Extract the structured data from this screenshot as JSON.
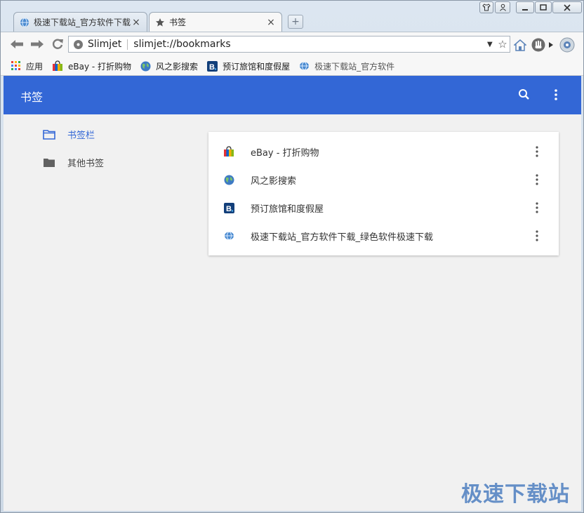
{
  "tabs": [
    {
      "title": "极速下载站_官方软件下载",
      "close": "×",
      "icon": "globe-icon"
    },
    {
      "title": "书签",
      "close": "×",
      "icon": "star-icon"
    }
  ],
  "window_controls": {
    "new_tab": "+"
  },
  "toolbar": {
    "site_name": "Slimjet",
    "url": "slimjet://bookmarks"
  },
  "bookmarks_bar": [
    {
      "label": "应用",
      "icon": "apps-grid-icon"
    },
    {
      "label": "eBay - 打折购物",
      "icon": "shopping-bag-icon"
    },
    {
      "label": "风之影搜索",
      "icon": "globe-icon"
    },
    {
      "label": "预订旅馆和度假屋",
      "icon": "booking-icon"
    },
    {
      "label": "极速下载站_官方软件",
      "icon": "globe-icon"
    }
  ],
  "page": {
    "title": "书签",
    "sidebar": [
      {
        "label": "书签栏",
        "selected": true
      },
      {
        "label": "其他书签",
        "selected": false
      }
    ],
    "bookmarks": [
      {
        "label": "eBay - 打折购物",
        "icon": "shopping-bag-icon"
      },
      {
        "label": "风之影搜索",
        "icon": "globe-icon"
      },
      {
        "label": "预订旅馆和度假屋",
        "icon": "booking-icon"
      },
      {
        "label": "极速下载站_官方软件下载_绿色软件极速下载",
        "icon": "globe-icon"
      }
    ]
  },
  "watermark": "极速下载站",
  "colors": {
    "accent": "#3367d6",
    "selected_folder": "#3367d6",
    "folder": "#616161"
  }
}
